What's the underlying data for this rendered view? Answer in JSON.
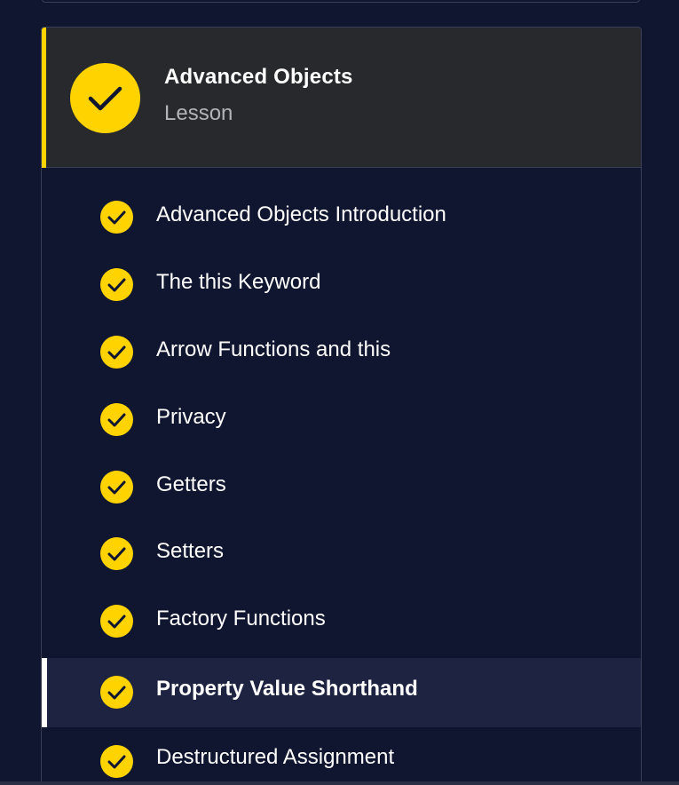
{
  "lesson": {
    "title": "Advanced Objects",
    "type": "Lesson",
    "accent_color": "#ffd300",
    "status_icon": "checkmark-icon"
  },
  "items": [
    {
      "label": "Advanced Objects Introduction",
      "completed": true,
      "active": false
    },
    {
      "label": "The this Keyword",
      "completed": true,
      "active": false
    },
    {
      "label": "Arrow Functions and this",
      "completed": true,
      "active": false
    },
    {
      "label": "Privacy",
      "completed": true,
      "active": false
    },
    {
      "label": "Getters",
      "completed": true,
      "active": false
    },
    {
      "label": "Setters",
      "completed": true,
      "active": false
    },
    {
      "label": "Factory Functions",
      "completed": true,
      "active": false
    },
    {
      "label": "Property Value Shorthand",
      "completed": true,
      "active": true
    },
    {
      "label": "Destructured Assignment",
      "completed": true,
      "active": false
    }
  ]
}
